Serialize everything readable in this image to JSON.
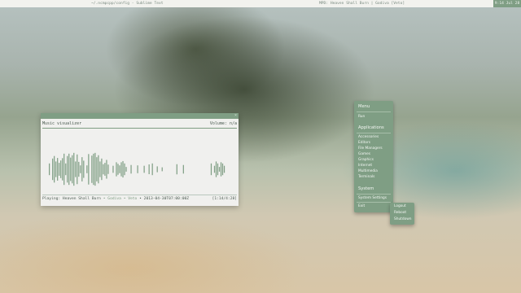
{
  "topbar": {
    "left_title": "~/.ncmpcpp/config - Sublime Text",
    "mid_title": "MPD: Heaven Shall Burn | Godiva [Veto]",
    "clock": "9:14 Jul 28"
  },
  "visualizer": {
    "title": "Music visualizer",
    "volume": "Volume: n/a",
    "status_prefix": "Playing:",
    "status_artist": "Heaven Shall Burn",
    "status_sep1": "•",
    "status_title": "Godiva",
    "status_sep2": "•",
    "status_album": "Veto",
    "status_sep3": "•",
    "status_date": "2013-04-30T07:00:00Z",
    "position": "[1:14/4:28]",
    "close_glyph": "×",
    "bar_color": "#7f9e84",
    "bars": [
      0.0,
      0.0,
      0.0,
      0.0,
      0.3,
      0.0,
      0.55,
      0.68,
      0.4,
      0.58,
      0.33,
      0.45,
      0.57,
      0.8,
      0.3,
      0.68,
      0.8,
      0.6,
      0.72,
      0.84,
      0.4,
      0.76,
      0.38,
      0.2,
      0.62,
      0.44,
      0.0,
      0.2,
      0.78,
      0.0,
      0.7,
      0.8,
      0.84,
      0.62,
      0.72,
      0.4,
      0.55,
      0.26,
      0.33,
      0.48,
      0.24,
      0.0,
      0.0,
      0.18,
      0.0,
      0.36,
      0.28,
      0.2,
      0.36,
      0.42,
      0.3,
      0.12,
      0.0,
      0.0,
      0.22,
      0.0,
      0.0,
      0.0,
      0.2,
      0.0,
      0.0,
      0.0,
      0.18,
      0.0,
      0.0,
      0.25,
      0.0,
      0.3,
      0.0,
      0.0,
      0.15,
      0.0,
      0.0,
      0.1,
      0.0,
      0.0,
      0.0,
      0.0,
      0.0,
      0.0,
      0.0,
      0.0,
      0.26,
      0.0,
      0.0,
      0.0,
      0.22,
      0.0,
      0.0,
      0.0,
      0.0,
      0.0,
      0.0,
      0.0,
      0.0,
      0.0,
      0.0,
      0.0,
      0.0,
      0.0,
      0.0,
      0.0,
      0.0,
      0.3,
      0.0,
      0.18,
      0.4,
      0.3,
      0.12,
      0.36,
      0.3,
      0.18,
      0.0,
      0.0,
      0.0,
      0.0,
      0.0,
      0.0,
      0.0
    ]
  },
  "main_menu": {
    "header": "Menu",
    "run": "Run",
    "applications_header": "Applications",
    "apps": [
      "Accessories",
      "Editors",
      "File Managers",
      "Games",
      "Graphics",
      "Internet",
      "Multimedia",
      "Terminals"
    ],
    "system_header": "System",
    "system_settings": "System Settings",
    "exit": "Exit"
  },
  "exit_menu": {
    "items": [
      "Logout",
      "Reboot",
      "Shutdown"
    ]
  }
}
